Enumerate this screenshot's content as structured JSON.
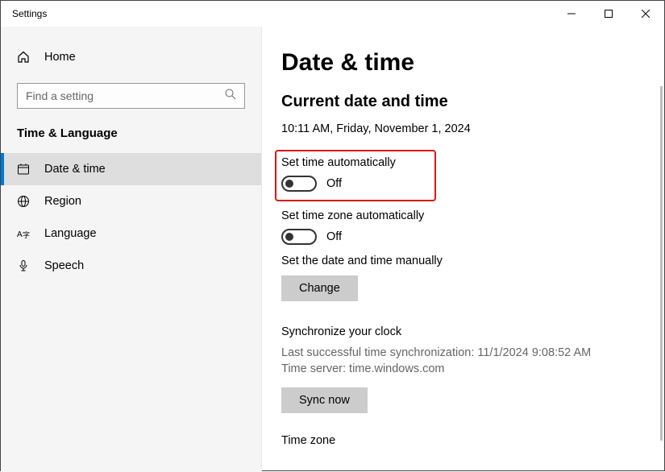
{
  "window": {
    "title": "Settings"
  },
  "sidebar": {
    "home_label": "Home",
    "search_placeholder": "Find a setting",
    "category_label": "Time & Language",
    "items": [
      {
        "label": "Date & time"
      },
      {
        "label": "Region"
      },
      {
        "label": "Language"
      },
      {
        "label": "Speech"
      }
    ]
  },
  "main": {
    "page_title": "Date & time",
    "section_current": "Current date and time",
    "current_datetime": "10:11 AM, Friday, November 1, 2024",
    "toggle_auto_time_label": "Set time automatically",
    "toggle_auto_time_state": "Off",
    "toggle_auto_tz_label": "Set time zone automatically",
    "toggle_auto_tz_state": "Off",
    "manual_label": "Set the date and time manually",
    "change_button": "Change",
    "sync_heading": "Synchronize your clock",
    "sync_last": "Last successful time synchronization: 11/1/2024 9:08:52 AM",
    "sync_server": "Time server: time.windows.com",
    "sync_button": "Sync now",
    "timezone_heading": "Time zone"
  }
}
